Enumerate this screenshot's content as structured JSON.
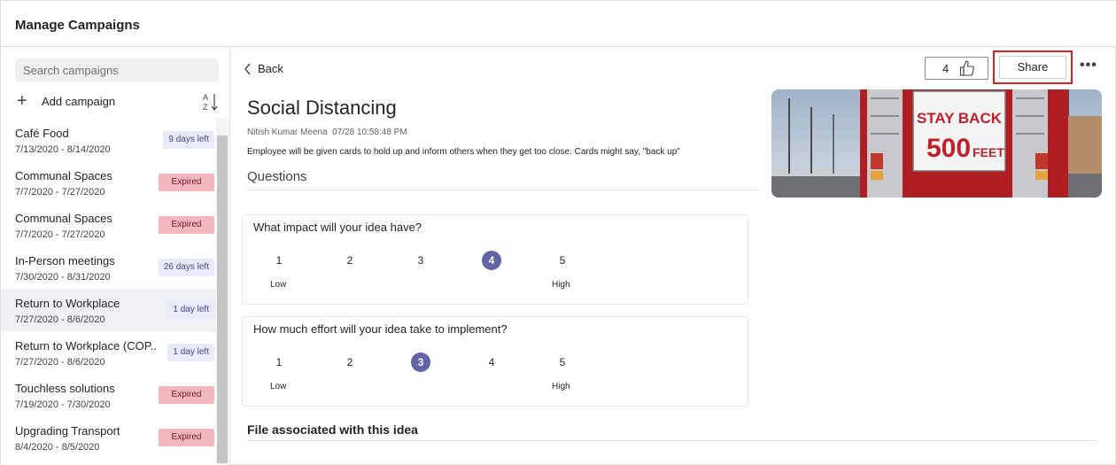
{
  "app": {
    "title": "Manage Campaigns"
  },
  "sidebar": {
    "search_placeholder": "Search campaigns",
    "add_label": "Add campaign",
    "items": [
      {
        "name": "Café Food",
        "dates": "7/13/2020 - 8/14/2020",
        "badge": "9 days left",
        "badge_type": "left"
      },
      {
        "name": "Communal Spaces",
        "dates": "7/7/2020 - 7/27/2020",
        "badge": "Expired",
        "badge_type": "expired"
      },
      {
        "name": "Communal Spaces",
        "dates": "7/7/2020 - 7/27/2020",
        "badge": "Expired",
        "badge_type": "expired"
      },
      {
        "name": "In-Person meetings",
        "dates": "7/30/2020 - 8/31/2020",
        "badge": "26 days left",
        "badge_type": "left"
      },
      {
        "name": "Return to Workplace",
        "dates": "7/27/2020 - 8/6/2020",
        "badge": "1 day left",
        "badge_type": "left",
        "active": true
      },
      {
        "name": "Return to Workplace (COP...",
        "dates": "7/27/2020 - 8/6/2020",
        "badge": "1 day left",
        "badge_type": "left"
      },
      {
        "name": "Touchless solutions",
        "dates": "7/19/2020 - 7/30/2020",
        "badge": "Expired",
        "badge_type": "expired"
      },
      {
        "name": "Upgrading Transport",
        "dates": "8/4/2020 - 8/5/2020",
        "badge": "Expired",
        "badge_type": "expired"
      }
    ]
  },
  "main": {
    "back_label": "Back",
    "like_count": "4",
    "share_label": "Share",
    "more_label": "•••",
    "idea_title": "Social Distancing",
    "author": "Nitish Kumar Meena",
    "timestamp": "07/28 10:58:48 PM",
    "description": "Employee will be given cards to hold up and inform others when they get too close. Cards might say, \"back up\"",
    "questions_header": "Questions",
    "questions": [
      {
        "text": "What impact will your idea have?",
        "options": [
          "1",
          "2",
          "3",
          "4",
          "5"
        ],
        "selected": "4",
        "low": "Low",
        "high": "High"
      },
      {
        "text": "How much effort will your idea take to implement?",
        "options": [
          "1",
          "2",
          "3",
          "4",
          "5"
        ],
        "selected": "3",
        "low": "Low",
        "high": "High"
      }
    ],
    "file_header": "File associated with this idea",
    "image_sign": {
      "line1": "STAY BACK",
      "line2": "500",
      "line3": "FEET"
    }
  },
  "colors": {
    "accent": "#6264a7",
    "expired_bg": "#f4b6bd",
    "days_left_bg": "#e8ebfa",
    "highlight": "#e02020"
  }
}
